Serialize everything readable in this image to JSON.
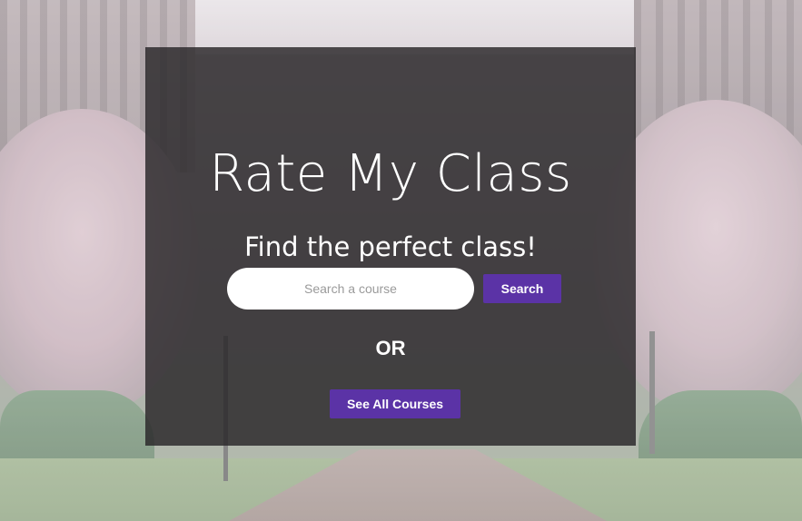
{
  "hero": {
    "title": "Rate My Class",
    "subtitle": "Find the perfect class!",
    "or_text": "OR"
  },
  "search": {
    "placeholder": "Search a course",
    "value": "",
    "button_label": "Search"
  },
  "actions": {
    "see_all_label": "See All Courses"
  },
  "colors": {
    "accent": "#5b33a6",
    "panel": "#282628",
    "text": "#ffffff"
  }
}
